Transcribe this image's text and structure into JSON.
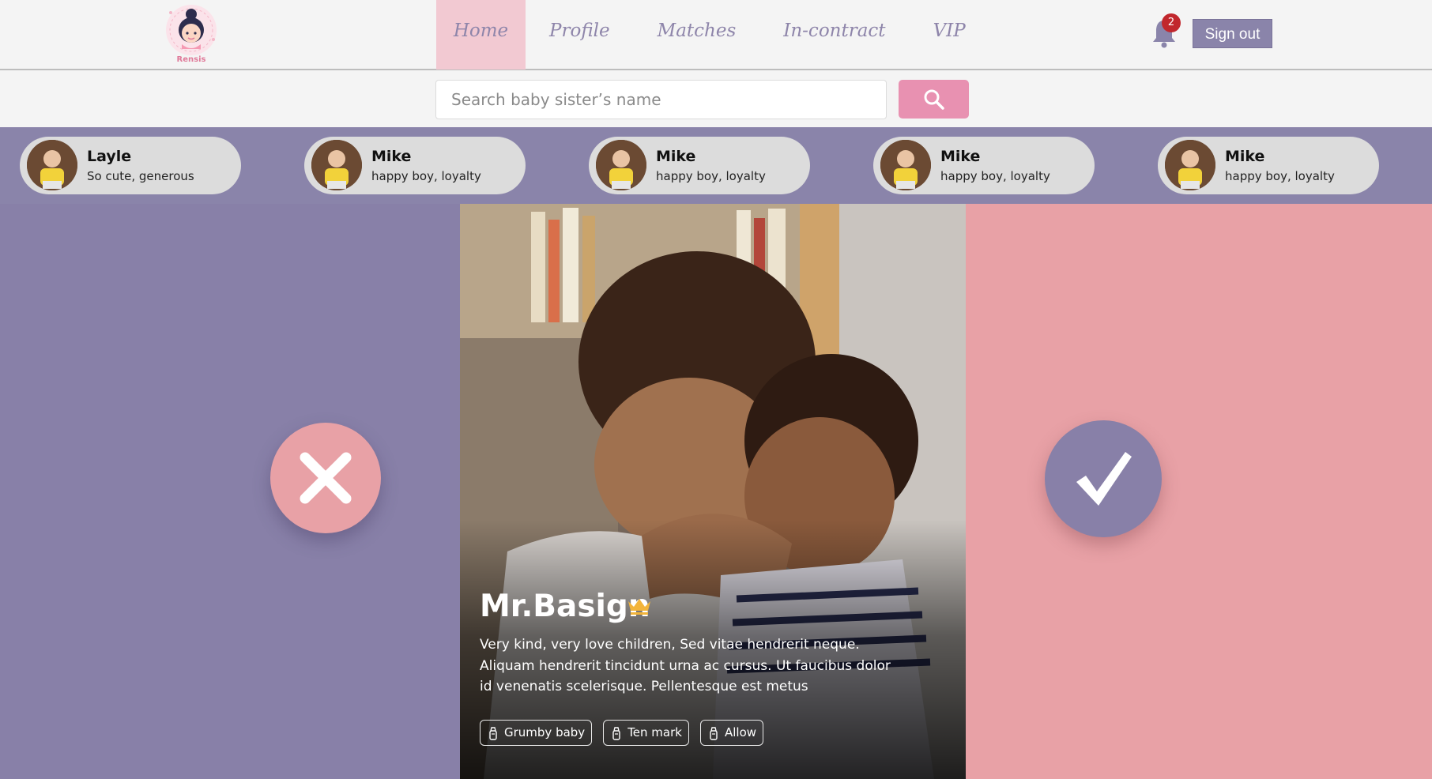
{
  "header": {
    "logo_text": "Rensis",
    "nav": [
      {
        "label": "Home",
        "active": true
      },
      {
        "label": "Profile",
        "active": false
      },
      {
        "label": "Matches",
        "active": false
      },
      {
        "label": "In-contract",
        "active": false
      },
      {
        "label": "VIP",
        "active": false
      }
    ],
    "notification_count": "2",
    "signout_label": "Sign out"
  },
  "search": {
    "placeholder": "Search baby sister’s name",
    "icon": "search-icon"
  },
  "strip": [
    {
      "name": "Layle",
      "desc": "So cute, generous"
    },
    {
      "name": "Mike",
      "desc": "happy boy, loyalty"
    },
    {
      "name": "Mike",
      "desc": "happy boy, loyalty"
    },
    {
      "name": "Mike",
      "desc": "happy boy, loyalty"
    },
    {
      "name": "Mike",
      "desc": "happy boy, loyalty"
    }
  ],
  "card": {
    "name": "Mr.Basign",
    "bio": "Very kind, very love children, Sed vitae hendrerit neque. Aliquam hendrerit tincidunt urna ac cursus. Ut faucibus dolor id venenatis scelerisque. Pellentesque est metus",
    "tags": [
      "Grumby baby",
      "Ten mark",
      "Allow"
    ],
    "badge_icon": "crown-icon"
  },
  "actions": {
    "reject_icon": "close-icon",
    "accept_icon": "check-icon"
  },
  "colors": {
    "purple": "#8880a8",
    "pink": "#e8a1a6",
    "nav_active": "#f2c9d2",
    "search_button": "#e891b1",
    "badge": "#c1272d",
    "crown": "#f2b43a"
  }
}
